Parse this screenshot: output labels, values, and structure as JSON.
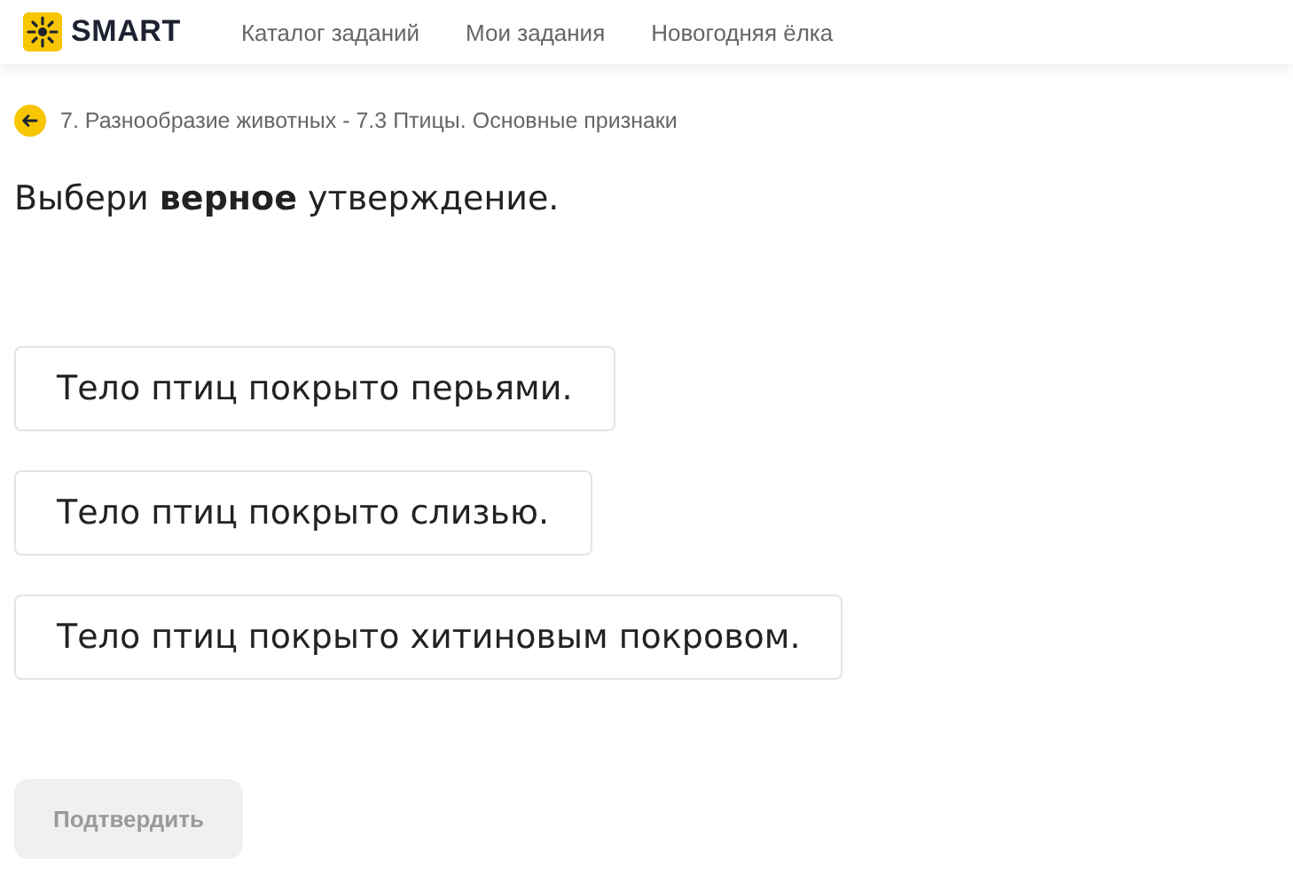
{
  "header": {
    "logo": "SMART",
    "nav": [
      {
        "label": "Каталог заданий"
      },
      {
        "label": "Мои задания"
      },
      {
        "label": "Новогодняя ёлка"
      }
    ]
  },
  "breadcrumb": "7. Разнообразие животных - 7.3 Птицы. Основные признаки",
  "question": "Выбери **верное** утверждение.",
  "options": [
    {
      "label": "Тело птиц покрыто перьями.",
      "selected": false
    },
    {
      "label": "Тело птиц покрыто слизью.",
      "selected": false
    },
    {
      "label": "Тело птиц покрыто хитиновым покровом.",
      "selected": false
    }
  ],
  "confirm": {
    "label": "Подтвердить",
    "disabled": true
  }
}
